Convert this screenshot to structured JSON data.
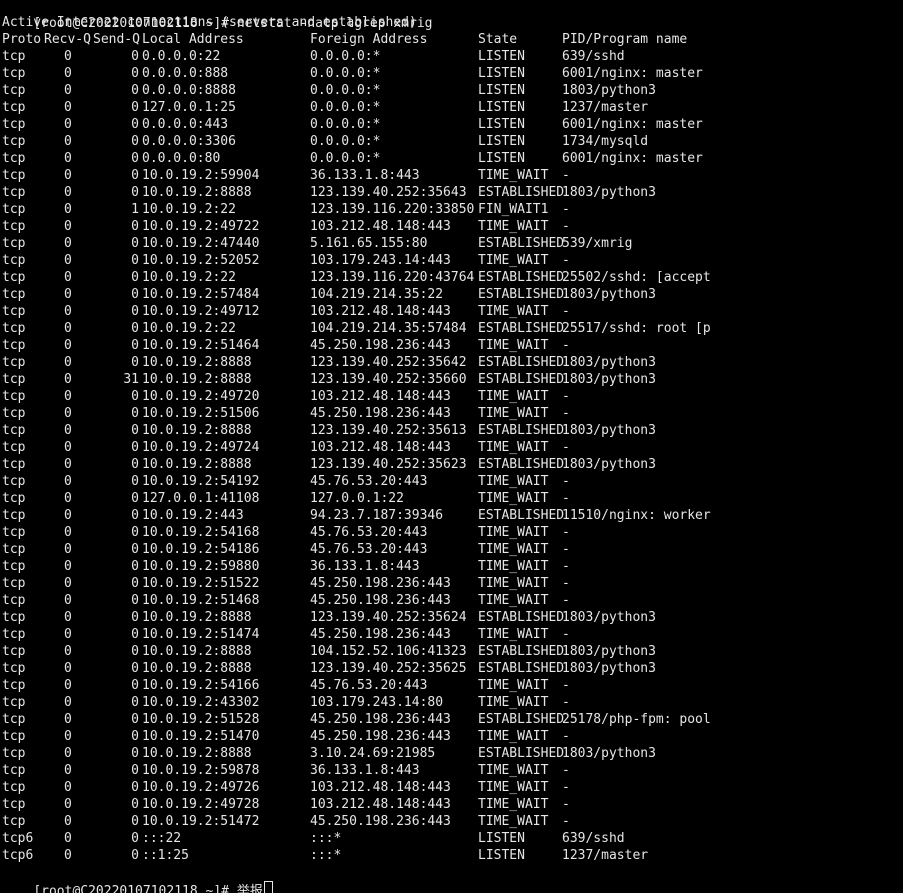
{
  "terminal": {
    "prompt": "[root@C20220107102118 ~]#",
    "command": "netstat -natp lgrep xmrig",
    "info_line": "Active Internet connections (servers and established)",
    "final_prompt": "[root@C20220107102118 ~]#",
    "final_input": "举报"
  },
  "columns": [
    "Proto",
    "Recv-Q",
    "Send-Q",
    "Local Address",
    "Foreign Address",
    "State",
    "PID/Program name"
  ],
  "rows": [
    [
      "tcp",
      "0",
      "0",
      "0.0.0.0:22",
      "0.0.0.0:*",
      "LISTEN",
      "639/sshd"
    ],
    [
      "tcp",
      "0",
      "0",
      "0.0.0.0:888",
      "0.0.0.0:*",
      "LISTEN",
      "6001/nginx: master"
    ],
    [
      "tcp",
      "0",
      "0",
      "0.0.0.0:8888",
      "0.0.0.0:*",
      "LISTEN",
      "1803/python3"
    ],
    [
      "tcp",
      "0",
      "0",
      "127.0.0.1:25",
      "0.0.0.0:*",
      "LISTEN",
      "1237/master"
    ],
    [
      "tcp",
      "0",
      "0",
      "0.0.0.0:443",
      "0.0.0.0:*",
      "LISTEN",
      "6001/nginx: master"
    ],
    [
      "tcp",
      "0",
      "0",
      "0.0.0.0:3306",
      "0.0.0.0:*",
      "LISTEN",
      "1734/mysqld"
    ],
    [
      "tcp",
      "0",
      "0",
      "0.0.0.0:80",
      "0.0.0.0:*",
      "LISTEN",
      "6001/nginx: master"
    ],
    [
      "tcp",
      "0",
      "0",
      "10.0.19.2:59904",
      "36.133.1.8:443",
      "TIME_WAIT",
      "-"
    ],
    [
      "tcp",
      "0",
      "0",
      "10.0.19.2:8888",
      "123.139.40.252:35643",
      "ESTABLISHED",
      "1803/python3"
    ],
    [
      "tcp",
      "0",
      "1",
      "10.0.19.2:22",
      "123.139.116.220:33850",
      "FIN_WAIT1",
      "-"
    ],
    [
      "tcp",
      "0",
      "0",
      "10.0.19.2:49722",
      "103.212.48.148:443",
      "TIME_WAIT",
      "-"
    ],
    [
      "tcp",
      "0",
      "0",
      "10.0.19.2:47440",
      "5.161.65.155:80",
      "ESTABLISHED",
      "539/xmrig"
    ],
    [
      "tcp",
      "0",
      "0",
      "10.0.19.2:52052",
      "103.179.243.14:443",
      "TIME_WAIT",
      "-"
    ],
    [
      "tcp",
      "0",
      "0",
      "10.0.19.2:22",
      "123.139.116.220:43764",
      "ESTABLISHED",
      "25502/sshd: [accept"
    ],
    [
      "tcp",
      "0",
      "0",
      "10.0.19.2:57484",
      "104.219.214.35:22",
      "ESTABLISHED",
      "1803/python3"
    ],
    [
      "tcp",
      "0",
      "0",
      "10.0.19.2:49712",
      "103.212.48.148:443",
      "TIME_WAIT",
      "-"
    ],
    [
      "tcp",
      "0",
      "0",
      "10.0.19.2:22",
      "104.219.214.35:57484",
      "ESTABLISHED",
      "25517/sshd: root [p"
    ],
    [
      "tcp",
      "0",
      "0",
      "10.0.19.2:51464",
      "45.250.198.236:443",
      "TIME_WAIT",
      "-"
    ],
    [
      "tcp",
      "0",
      "0",
      "10.0.19.2:8888",
      "123.139.40.252:35642",
      "ESTABLISHED",
      "1803/python3"
    ],
    [
      "tcp",
      "0",
      "31",
      "10.0.19.2:8888",
      "123.139.40.252:35660",
      "ESTABLISHED",
      "1803/python3"
    ],
    [
      "tcp",
      "0",
      "0",
      "10.0.19.2:49720",
      "103.212.48.148:443",
      "TIME_WAIT",
      "-"
    ],
    [
      "tcp",
      "0",
      "0",
      "10.0.19.2:51506",
      "45.250.198.236:443",
      "TIME_WAIT",
      "-"
    ],
    [
      "tcp",
      "0",
      "0",
      "10.0.19.2:8888",
      "123.139.40.252:35613",
      "ESTABLISHED",
      "1803/python3"
    ],
    [
      "tcp",
      "0",
      "0",
      "10.0.19.2:49724",
      "103.212.48.148:443",
      "TIME_WAIT",
      "-"
    ],
    [
      "tcp",
      "0",
      "0",
      "10.0.19.2:8888",
      "123.139.40.252:35623",
      "ESTABLISHED",
      "1803/python3"
    ],
    [
      "tcp",
      "0",
      "0",
      "10.0.19.2:54192",
      "45.76.53.20:443",
      "TIME_WAIT",
      "-"
    ],
    [
      "tcp",
      "0",
      "0",
      "127.0.0.1:41108",
      "127.0.0.1:22",
      "TIME_WAIT",
      "-"
    ],
    [
      "tcp",
      "0",
      "0",
      "10.0.19.2:443",
      "94.23.7.187:39346",
      "ESTABLISHED",
      "11510/nginx: worker"
    ],
    [
      "tcp",
      "0",
      "0",
      "10.0.19.2:54168",
      "45.76.53.20:443",
      "TIME_WAIT",
      "-"
    ],
    [
      "tcp",
      "0",
      "0",
      "10.0.19.2:54186",
      "45.76.53.20:443",
      "TIME_WAIT",
      "-"
    ],
    [
      "tcp",
      "0",
      "0",
      "10.0.19.2:59880",
      "36.133.1.8:443",
      "TIME_WAIT",
      "-"
    ],
    [
      "tcp",
      "0",
      "0",
      "10.0.19.2:51522",
      "45.250.198.236:443",
      "TIME_WAIT",
      "-"
    ],
    [
      "tcp",
      "0",
      "0",
      "10.0.19.2:51468",
      "45.250.198.236:443",
      "TIME_WAIT",
      "-"
    ],
    [
      "tcp",
      "0",
      "0",
      "10.0.19.2:8888",
      "123.139.40.252:35624",
      "ESTABLISHED",
      "1803/python3"
    ],
    [
      "tcp",
      "0",
      "0",
      "10.0.19.2:51474",
      "45.250.198.236:443",
      "TIME_WAIT",
      "-"
    ],
    [
      "tcp",
      "0",
      "0",
      "10.0.19.2:8888",
      "104.152.52.106:41323",
      "ESTABLISHED",
      "1803/python3"
    ],
    [
      "tcp",
      "0",
      "0",
      "10.0.19.2:8888",
      "123.139.40.252:35625",
      "ESTABLISHED",
      "1803/python3"
    ],
    [
      "tcp",
      "0",
      "0",
      "10.0.19.2:54166",
      "45.76.53.20:443",
      "TIME_WAIT",
      "-"
    ],
    [
      "tcp",
      "0",
      "0",
      "10.0.19.2:43302",
      "103.179.243.14:80",
      "TIME_WAIT",
      "-"
    ],
    [
      "tcp",
      "0",
      "0",
      "10.0.19.2:51528",
      "45.250.198.236:443",
      "ESTABLISHED",
      "25178/php-fpm: pool"
    ],
    [
      "tcp",
      "0",
      "0",
      "10.0.19.2:51470",
      "45.250.198.236:443",
      "TIME_WAIT",
      "-"
    ],
    [
      "tcp",
      "0",
      "0",
      "10.0.19.2:8888",
      "3.10.24.69:21985",
      "ESTABLISHED",
      "1803/python3"
    ],
    [
      "tcp",
      "0",
      "0",
      "10.0.19.2:59878",
      "36.133.1.8:443",
      "TIME_WAIT",
      "-"
    ],
    [
      "tcp",
      "0",
      "0",
      "10.0.19.2:49726",
      "103.212.48.148:443",
      "TIME_WAIT",
      "-"
    ],
    [
      "tcp",
      "0",
      "0",
      "10.0.19.2:49728",
      "103.212.48.148:443",
      "TIME_WAIT",
      "-"
    ],
    [
      "tcp",
      "0",
      "0",
      "10.0.19.2:51472",
      "45.250.198.236:443",
      "TIME_WAIT",
      "-"
    ],
    [
      "tcp6",
      "0",
      "0",
      ":::22",
      ":::*",
      "LISTEN",
      "639/sshd"
    ],
    [
      "tcp6",
      "0",
      "0",
      "::1:25",
      ":::*",
      "LISTEN",
      "1237/master"
    ]
  ]
}
